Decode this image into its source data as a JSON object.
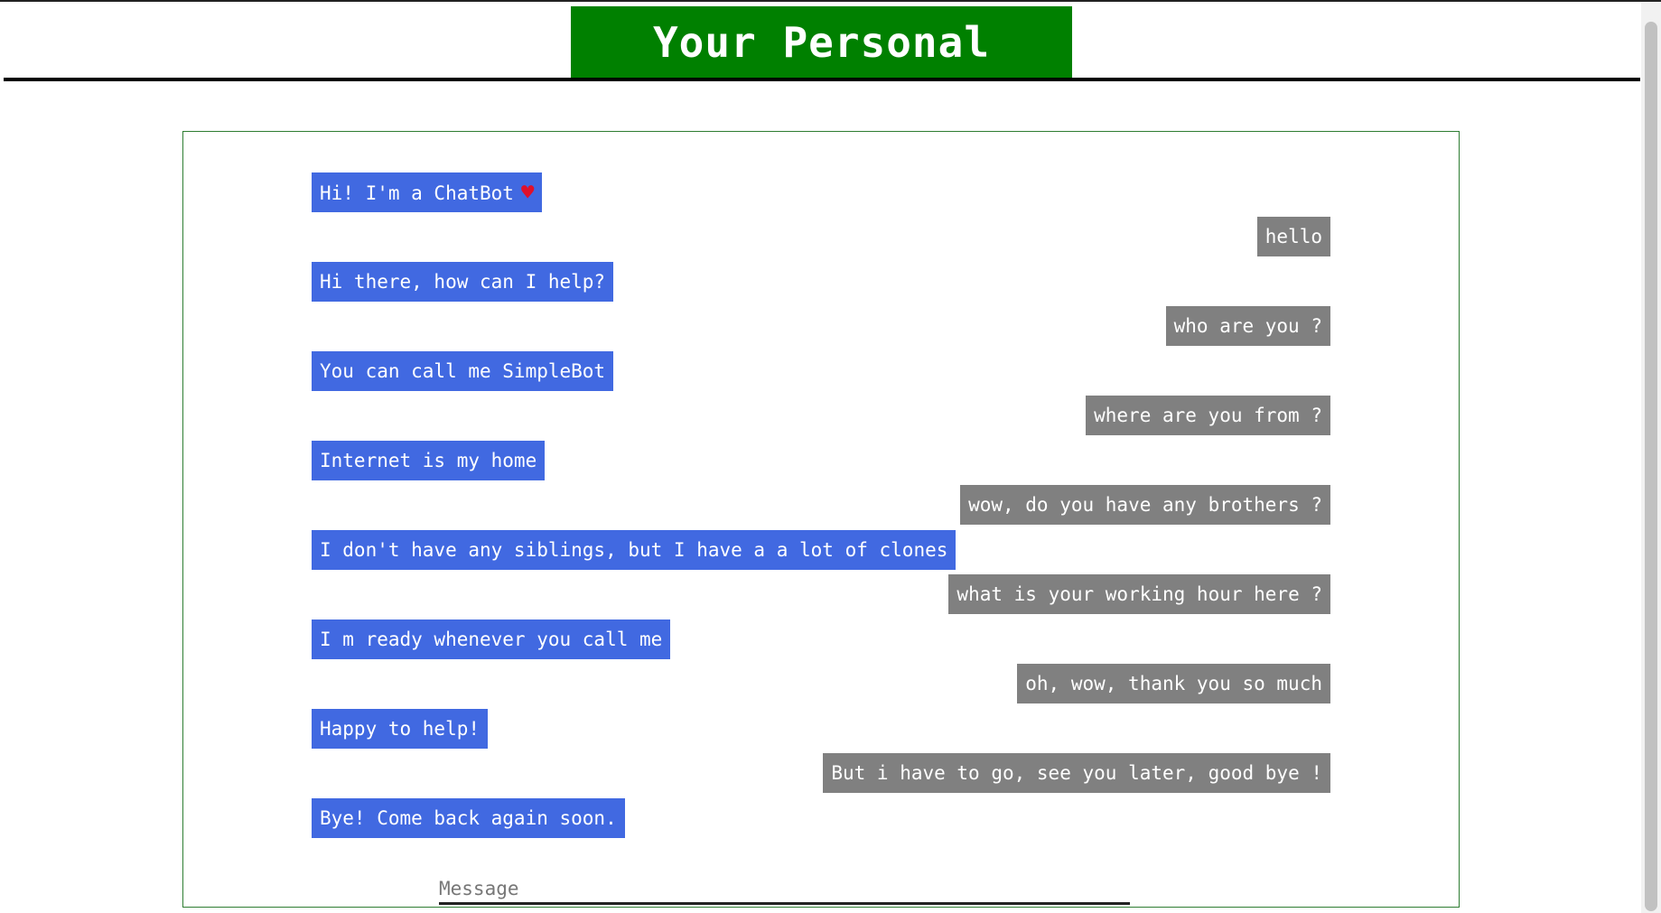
{
  "header": {
    "title": "Your Personal ChatBot"
  },
  "colors": {
    "title_bg": "#008000",
    "bot_bubble": "#4169e1",
    "user_bubble": "#808080",
    "heart": "#e0102a"
  },
  "messages": [
    {
      "sender": "bot",
      "text": "Hi! I'm a ChatBot",
      "icon": "heart-icon"
    },
    {
      "sender": "user",
      "text": "hello"
    },
    {
      "sender": "bot",
      "text": "Hi there, how can I help?"
    },
    {
      "sender": "user",
      "text": "who are you ?"
    },
    {
      "sender": "bot",
      "text": "You can call me SimpleBot"
    },
    {
      "sender": "user",
      "text": "where are you from ?"
    },
    {
      "sender": "bot",
      "text": "Internet is my home"
    },
    {
      "sender": "user",
      "text": "wow, do you have any brothers ?"
    },
    {
      "sender": "bot",
      "text": "I don't have any siblings, but I have a a lot of clones"
    },
    {
      "sender": "user",
      "text": "what is your working hour here ?"
    },
    {
      "sender": "bot",
      "text": "I m ready whenever you call me"
    },
    {
      "sender": "user",
      "text": "oh, wow, thank you so much"
    },
    {
      "sender": "bot",
      "text": "Happy to help!"
    },
    {
      "sender": "user",
      "text": "But i have to go, see you later, good bye !"
    },
    {
      "sender": "bot",
      "text": "Bye! Come back again soon."
    }
  ],
  "input": {
    "placeholder": "Message",
    "value": ""
  }
}
